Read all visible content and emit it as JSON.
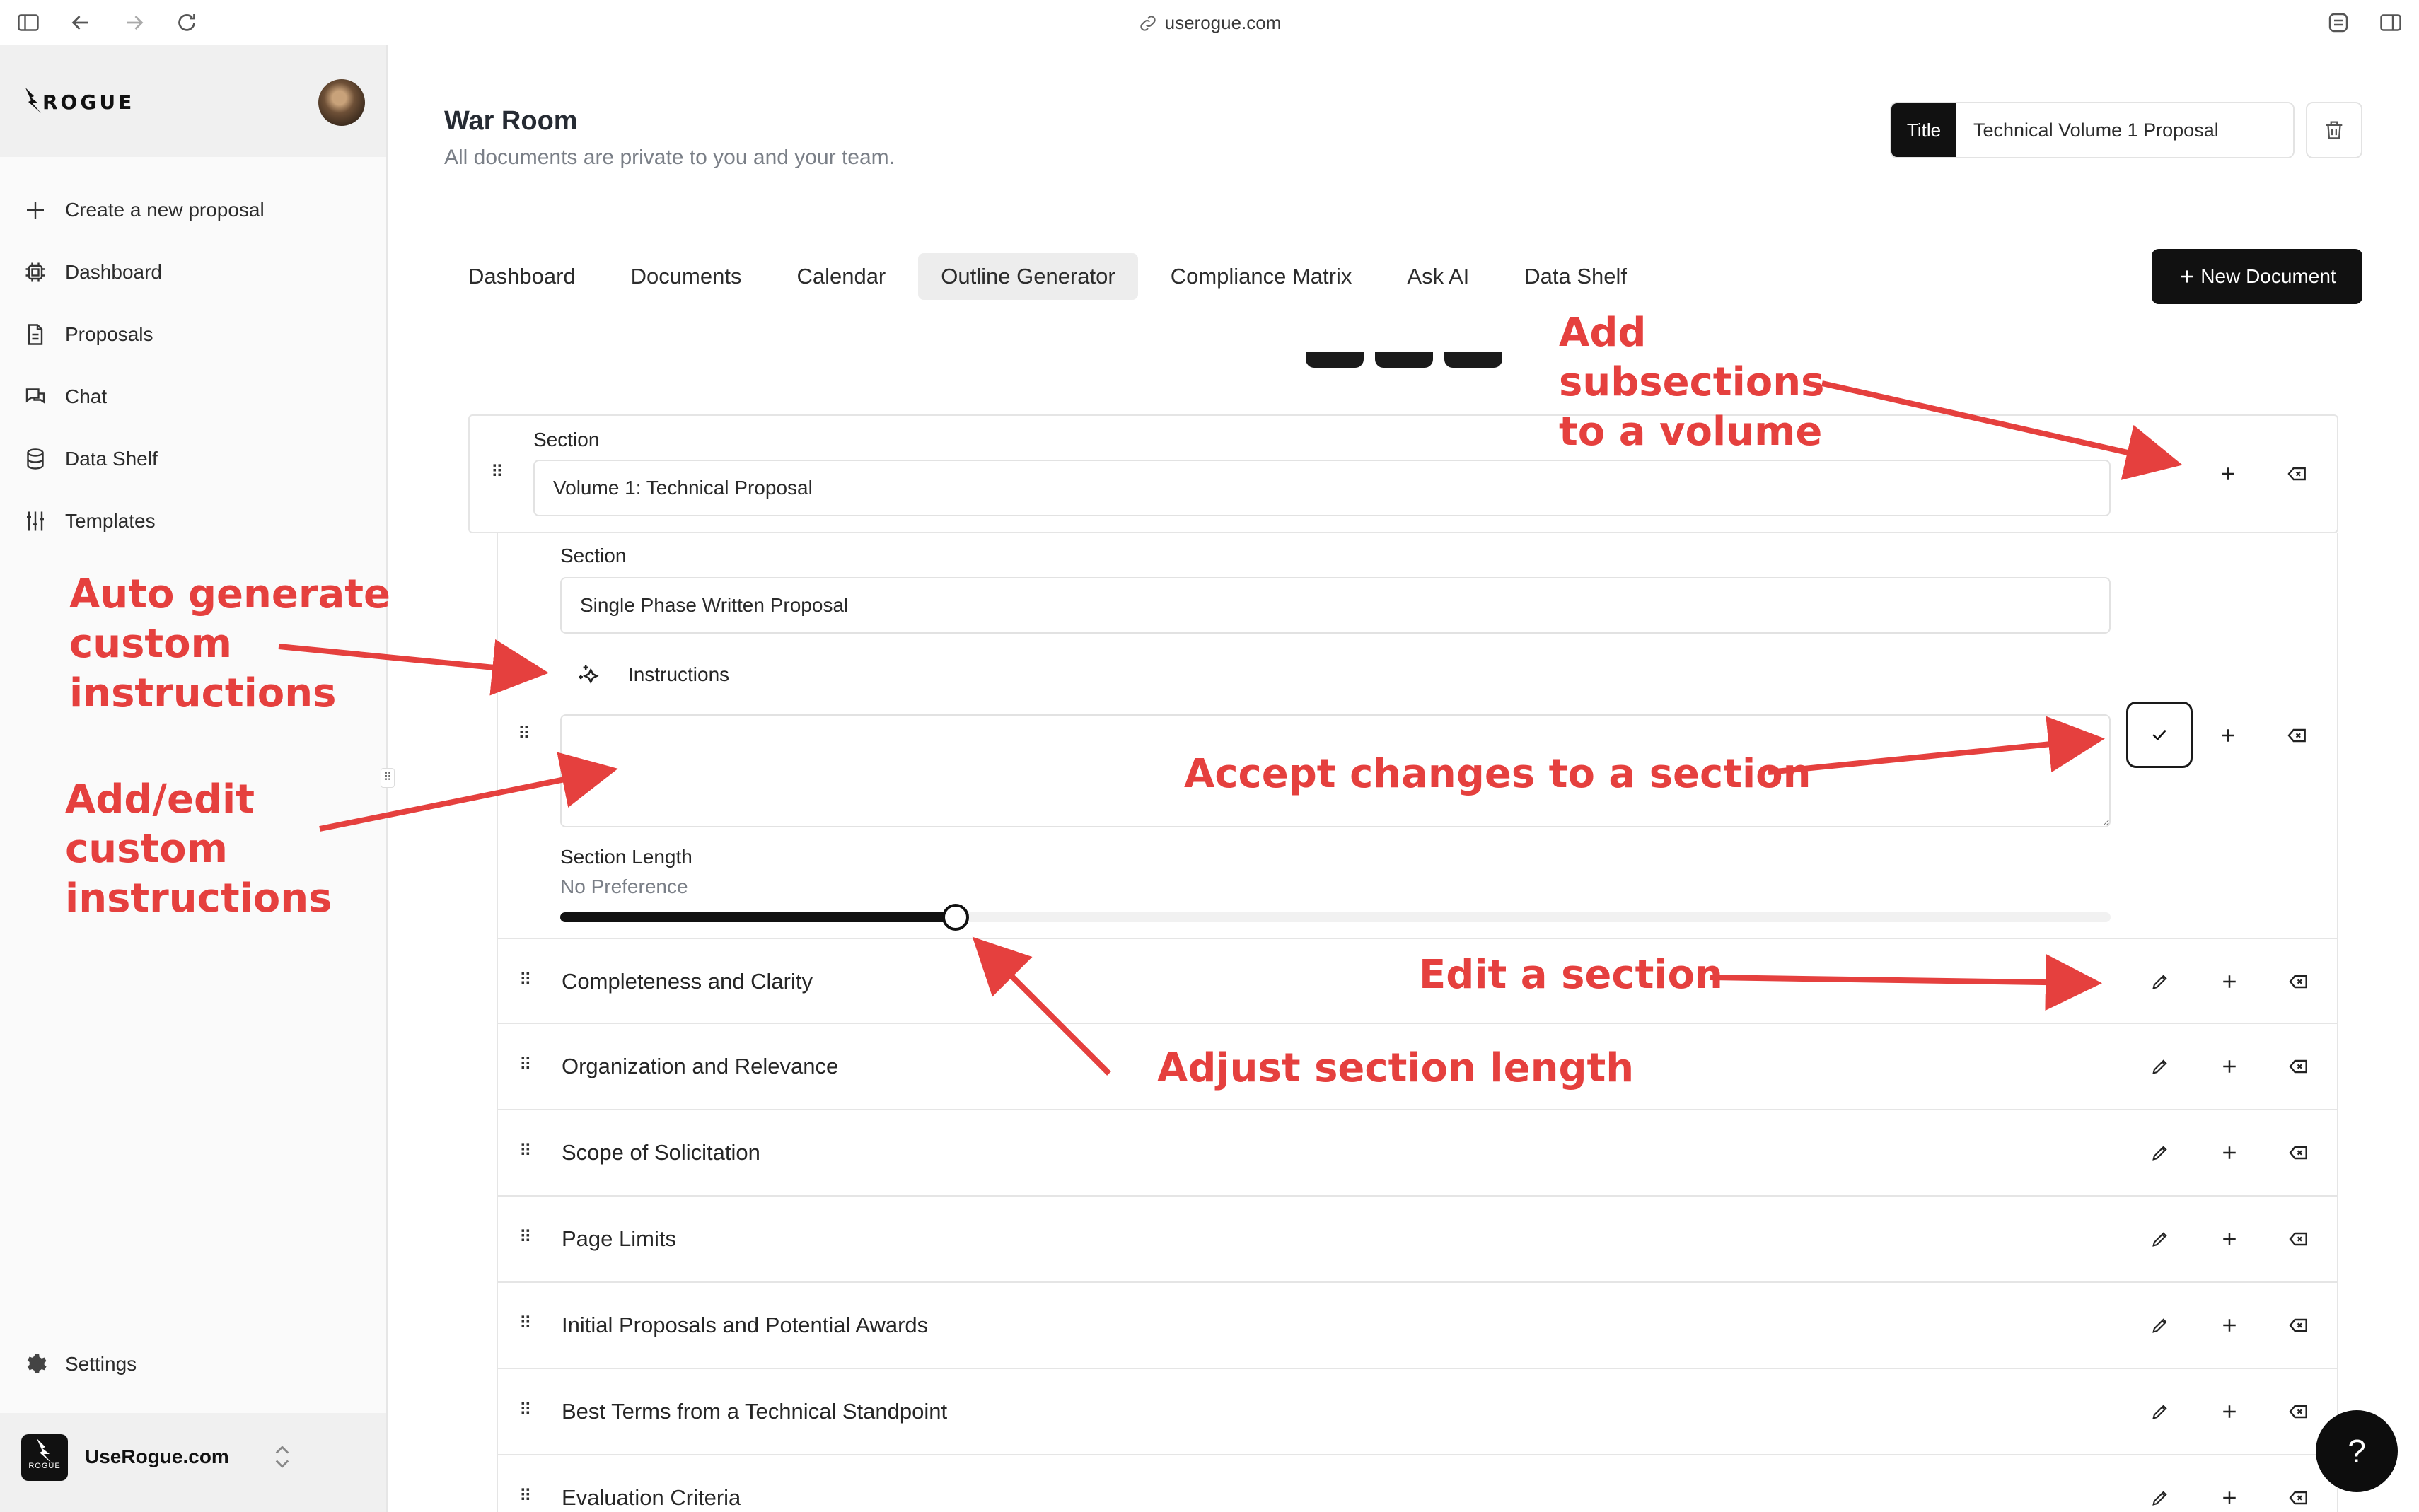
{
  "browser": {
    "url": "userogue.com"
  },
  "sidebar": {
    "logo_text": "ROGUE",
    "items": [
      {
        "label": "Create a new proposal",
        "icon": "plus-icon"
      },
      {
        "label": "Dashboard",
        "icon": "chip-icon"
      },
      {
        "label": "Proposals",
        "icon": "document-icon"
      },
      {
        "label": "Chat",
        "icon": "chat-icon"
      },
      {
        "label": "Data Shelf",
        "icon": "database-icon"
      },
      {
        "label": "Templates",
        "icon": "sliders-icon"
      }
    ],
    "settings_label": "Settings",
    "workspace_name": "UseRogue.com",
    "workspace_logo_text": "ROGUE"
  },
  "header": {
    "title": "War Room",
    "subtitle": "All documents are private to you and your team.",
    "title_tag": "Title",
    "title_value": "Technical Volume 1 Proposal",
    "new_document": "New Document"
  },
  "tabs": [
    {
      "label": "Dashboard",
      "active": false
    },
    {
      "label": "Documents",
      "active": false
    },
    {
      "label": "Calendar",
      "active": false
    },
    {
      "label": "Outline Generator",
      "active": true
    },
    {
      "label": "Compliance Matrix",
      "active": false
    },
    {
      "label": "Ask AI",
      "active": false
    },
    {
      "label": "Data Shelf",
      "active": false
    }
  ],
  "outline": {
    "volume": {
      "label": "Section",
      "value": "Volume 1: Technical Proposal"
    },
    "editing": {
      "label": "Section",
      "value": "Single Phase Written Proposal",
      "instructions_label": "Instructions",
      "instructions_value": "",
      "length_label": "Section Length",
      "length_value": "No Preference",
      "length_fraction": 0.255
    },
    "rows": [
      "Completeness and Clarity",
      "Organization and Relevance",
      "Scope of Solicitation",
      "Page Limits",
      "Initial Proposals and Potential Awards",
      "Best Terms from a Technical Standpoint",
      "Evaluation Criteria"
    ]
  },
  "annotations": {
    "add_subsections": "Add\nsubsections\nto a volume",
    "auto_generate": "Auto generate\ncustom\ninstructions",
    "add_edit": "Add/edit\ncustom\ninstructions",
    "accept": "Accept changes to a section",
    "edit": "Edit a section",
    "adjust": "Adjust section length"
  },
  "help_label": "?",
  "colors": {
    "annotation": "#e5403e",
    "primary": "#111111",
    "active_tab": "#ededed"
  }
}
